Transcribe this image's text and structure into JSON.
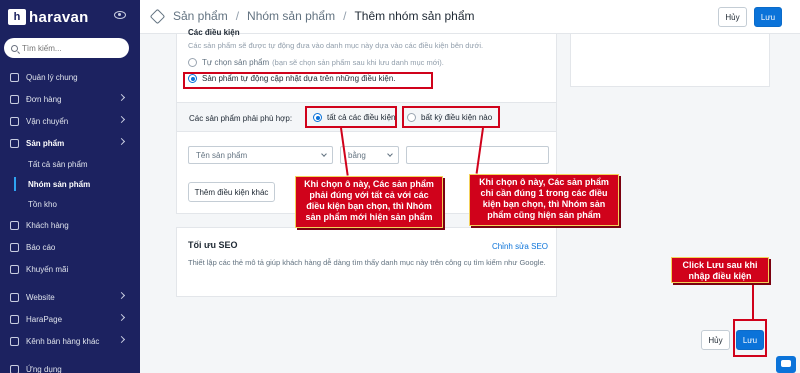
{
  "app": {
    "logo_text": "haravan",
    "logo_mark": "h"
  },
  "sidebar": {
    "search_placeholder": "Tìm kiếm...",
    "items": [
      {
        "label": "Quản lý chung",
        "icon": "home-icon"
      },
      {
        "label": "Đơn hàng",
        "icon": "inbox-icon"
      },
      {
        "label": "Vận chuyển",
        "icon": "truck-icon"
      },
      {
        "label": "Sản phẩm",
        "icon": "tag-icon"
      },
      {
        "label": "Khách hàng",
        "icon": "user-icon"
      },
      {
        "label": "Báo cáo",
        "icon": "chart-icon"
      },
      {
        "label": "Khuyến mãi",
        "icon": "percent-icon"
      },
      {
        "label": "Website",
        "icon": "globe-icon"
      },
      {
        "label": "HaraPage",
        "icon": "page-icon"
      },
      {
        "label": "Kênh bán hàng khác",
        "icon": "share-icon"
      },
      {
        "label": "Ứng dụng",
        "icon": "apps-icon"
      }
    ],
    "sub_items": [
      {
        "label": "Tất cả sản phẩm"
      },
      {
        "label": "Nhóm sản phẩm"
      },
      {
        "label": "Tồn kho"
      }
    ]
  },
  "header": {
    "breadcrumb": [
      "Sản phẩm",
      "Nhóm sản phẩm",
      "Thêm nhóm sản phẩm"
    ],
    "cancel_label": "Hủy",
    "save_label": "Lưu"
  },
  "conditions": {
    "title": "Các điều kiện",
    "description": "Các sản phẩm sẽ được tự động đưa vào danh mục này dựa vào các điều kiện bên dưới.",
    "option_manual": "Tự chọn sản phẩm",
    "option_manual_hint": "(bạn sẽ chọn sản phẩm sau khi lưu danh mục mới).",
    "option_auto": "Sản phẩm tự động cập nhật dựa trên những điều kiện.",
    "match_label": "Các sản phẩm phải phù hợp:",
    "match_all": "tất cả các điều kiện",
    "match_any": "bất kỳ điều kiện nào",
    "field_select": "Tên sản phẩm",
    "operator_select": "bằng",
    "value_input": "",
    "add_condition": "Thêm điều kiện khác"
  },
  "seo": {
    "title": "Tối ưu SEO",
    "edit_link": "Chỉnh sửa SEO",
    "description": "Thiết lập các thẻ mô tả giúp khách hàng dễ dàng tìm thấy danh mục này trên công cụ tìm kiếm như Google."
  },
  "footer": {
    "cancel_label": "Hủy",
    "save_label": "Lưu"
  },
  "annotations": {
    "callout_all": "Khi chọn ô này, Các sản phẩm phải đúng với tất cả với các điều kiện bạn chọn, thì Nhóm sản phẩm mới hiện sản phẩm",
    "callout_any": "Khi chọn ô này, Các sản phẩm chỉ cần đúng 1 trong các điều kiện bạn chọn, thì Nhóm sản phẩm cũng hiện sản phẩm",
    "callout_save": "Click Lưu sau khi nhập điều kiện"
  },
  "colors": {
    "sidebar": "#1c2260",
    "primary": "#0b73d9",
    "annotation_red": "#d0021b"
  }
}
